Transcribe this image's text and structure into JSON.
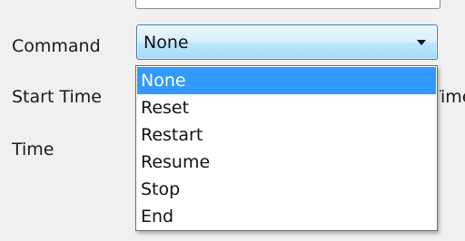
{
  "form": {
    "command_label": "Command",
    "start_time_label": "Start Time",
    "time_label": "Time",
    "obscured_text": "Time"
  },
  "command_select": {
    "value": "None",
    "options": [
      {
        "label": "None",
        "selected": true
      },
      {
        "label": "Reset",
        "selected": false
      },
      {
        "label": "Restart",
        "selected": false
      },
      {
        "label": "Resume",
        "selected": false
      },
      {
        "label": "Stop",
        "selected": false
      },
      {
        "label": "End",
        "selected": false
      }
    ]
  },
  "icons": {
    "combo_arrow": "chevron-down-icon"
  },
  "colors": {
    "highlight": "#3399ff",
    "highlight_text": "#ffffff",
    "combo_border": "#3c7fb1"
  }
}
